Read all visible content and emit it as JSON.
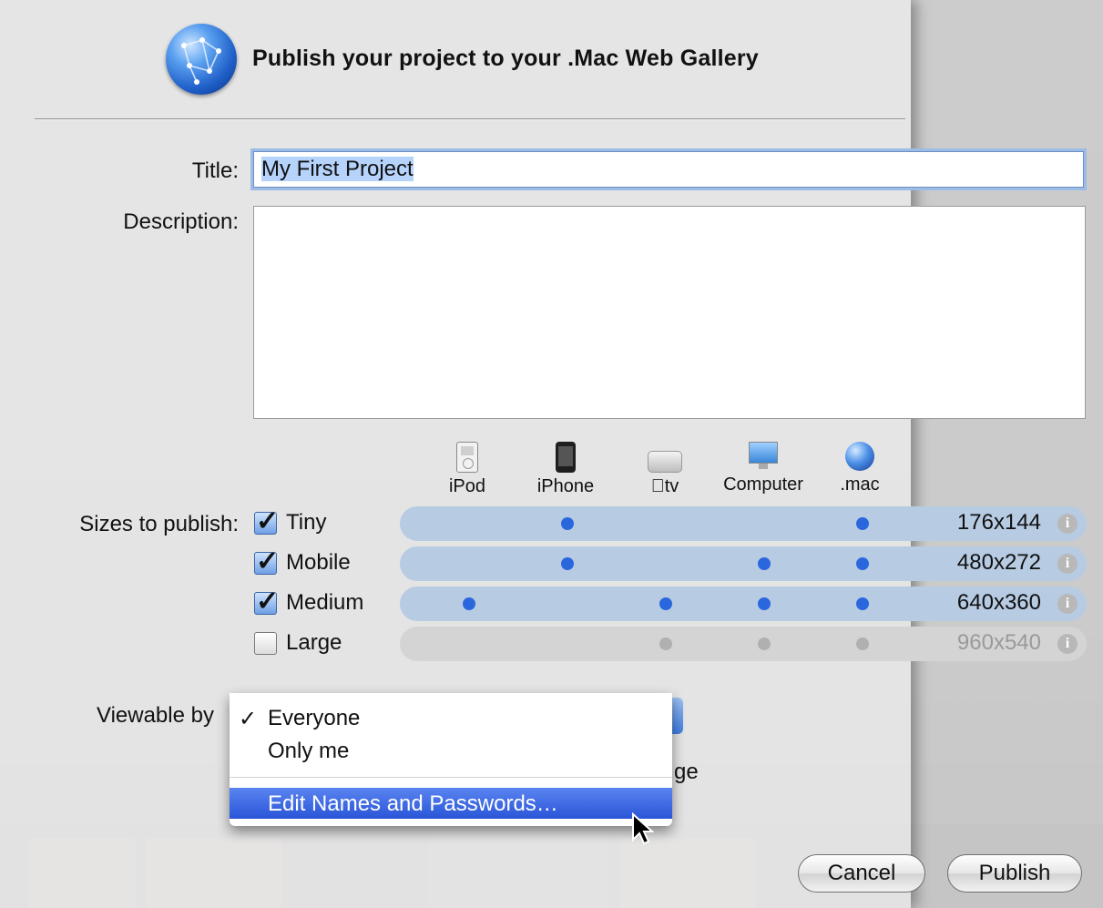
{
  "header": {
    "title": "Publish your project to your .Mac Web Gallery",
    "icon": "dotmac-globe-icon"
  },
  "form": {
    "title_label": "Title:",
    "title_value": "My First Project",
    "description_label": "Description:",
    "description_value": "",
    "sizes_label": "Sizes to publish:",
    "viewable_label": "Viewable by",
    "hide_label_suffix": "ge"
  },
  "devices": [
    {
      "label": "iPod",
      "icon": "ipod-icon"
    },
    {
      "label": "iPhone",
      "icon": "iphone-icon"
    },
    {
      "label": "tv",
      "icon": "appletv-icon"
    },
    {
      "label": "Computer",
      "icon": "computer-icon"
    },
    {
      "label": ".mac",
      "icon": "dotmac-icon"
    }
  ],
  "sizes": [
    {
      "name": "Tiny",
      "checked": true,
      "resolution": "176x144",
      "devices": [
        false,
        true,
        false,
        false,
        true
      ]
    },
    {
      "name": "Mobile",
      "checked": true,
      "resolution": "480x272",
      "devices": [
        false,
        true,
        false,
        true,
        true
      ]
    },
    {
      "name": "Medium",
      "checked": true,
      "resolution": "640x360",
      "devices": [
        true,
        false,
        true,
        true,
        true
      ]
    },
    {
      "name": "Large",
      "checked": false,
      "resolution": "960x540",
      "devices": [
        false,
        false,
        true,
        true,
        true
      ]
    }
  ],
  "viewable_menu": {
    "check_mark": "✓",
    "items": [
      {
        "label": "Everyone",
        "selected": true
      },
      {
        "label": "Only me",
        "selected": false
      },
      {
        "label": "Edit Names and Passwords…",
        "selected": false,
        "highlighted": true
      }
    ]
  },
  "buttons": {
    "cancel": "Cancel",
    "publish": "Publish"
  },
  "colors": {
    "accent": "#2a67dd",
    "menu_highlight": "#3a63e0",
    "row_on": "#b7cbe3",
    "row_off": "#d4d4d4"
  }
}
